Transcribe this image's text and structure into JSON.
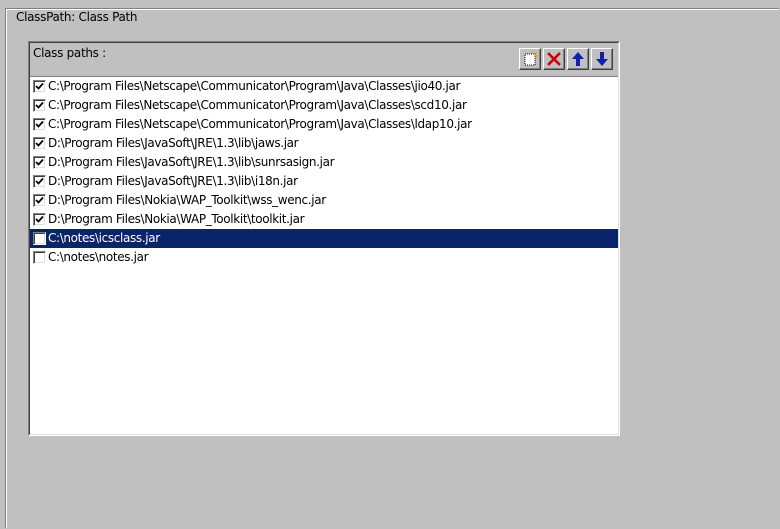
{
  "groupbox": {
    "title": "ClassPath: Class Path"
  },
  "panel": {
    "header_label": "Class paths :",
    "toolbar": [
      {
        "name": "new-item-icon",
        "tooltip": ""
      },
      {
        "name": "delete-icon",
        "tooltip": ""
      },
      {
        "name": "move-up-icon",
        "tooltip": ""
      },
      {
        "name": "move-down-icon",
        "tooltip": ""
      }
    ]
  },
  "colors": {
    "selection": "#0a246a",
    "delete_icon": "#cc0000",
    "arrow_icon": "#1020b0",
    "face": "#c0c0c0"
  },
  "classpaths": [
    {
      "path": "C:\\Program Files\\Netscape\\Communicator\\Program\\Java\\Classes\\jio40.jar",
      "checked": true,
      "selected": false
    },
    {
      "path": "C:\\Program Files\\Netscape\\Communicator\\Program\\Java\\Classes\\scd10.jar",
      "checked": true,
      "selected": false
    },
    {
      "path": "C:\\Program Files\\Netscape\\Communicator\\Program\\Java\\Classes\\ldap10.jar",
      "checked": true,
      "selected": false
    },
    {
      "path": "D:\\Program Files\\JavaSoft\\JRE\\1.3\\lib\\jaws.jar",
      "checked": true,
      "selected": false
    },
    {
      "path": "D:\\Program Files\\JavaSoft\\JRE\\1.3\\lib\\sunrsasign.jar",
      "checked": true,
      "selected": false
    },
    {
      "path": "D:\\Program Files\\JavaSoft\\JRE\\1.3\\lib\\i18n.jar",
      "checked": true,
      "selected": false
    },
    {
      "path": "D:\\Program Files\\Nokia\\WAP_Toolkit\\wss_wenc.jar",
      "checked": true,
      "selected": false
    },
    {
      "path": "D:\\Program Files\\Nokia\\WAP_Toolkit\\toolkit.jar",
      "checked": true,
      "selected": false
    },
    {
      "path": "C:\\notes\\icsclass.jar",
      "checked": false,
      "selected": true
    },
    {
      "path": "C:\\notes\\notes.jar",
      "checked": false,
      "selected": false
    }
  ]
}
